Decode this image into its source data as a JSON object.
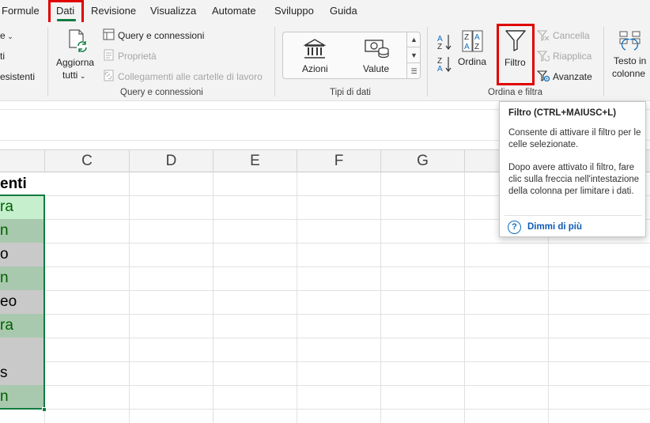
{
  "menu": {
    "tabs": [
      {
        "label": "Formule"
      },
      {
        "label": "Dati"
      },
      {
        "label": "Revisione"
      },
      {
        "label": "Visualizza"
      },
      {
        "label": "Automate"
      },
      {
        "label": "Sviluppo"
      },
      {
        "label": "Guida"
      }
    ],
    "active_tab": "Dati"
  },
  "ribbon": {
    "left_cut": {
      "item1": "e",
      "item2": "ti",
      "item3": "esistenti"
    },
    "query_group": {
      "refresh_label_1": "Aggiorna",
      "refresh_label_2": "tutti",
      "queries_connections": "Query e connessioni",
      "properties": "Proprietà",
      "edit_links": "Collegamenti alle cartelle di lavoro",
      "group_label": "Query e connessioni"
    },
    "datatypes_group": {
      "stocks": "Azioni",
      "currencies": "Valute",
      "group_label": "Tipi di dati"
    },
    "sort_filter_group": {
      "sort": "Ordina",
      "filter": "Filtro",
      "clear": "Cancella",
      "reapply": "Riapplica",
      "advanced": "Avanzate",
      "group_label": "Ordina e filtra"
    },
    "data_tools_group": {
      "text_to_columns_1": "Testo in",
      "text_to_columns_2": "colonne"
    }
  },
  "grid": {
    "columns": [
      "C",
      "D",
      "E",
      "F",
      "G"
    ],
    "column_b_cells": [
      {
        "text": "enti",
        "bold": true,
        "fill": "#ffffff",
        "color": "#000000"
      },
      {
        "text": "ra",
        "bold": false,
        "fill": "#c6efce",
        "color": "#006100"
      },
      {
        "text": "n",
        "bold": false,
        "fill": "#a9c9ae",
        "color": "#006100"
      },
      {
        "text": "o",
        "bold": false,
        "fill": "#c9c9c9",
        "color": "#000000"
      },
      {
        "text": "n",
        "bold": false,
        "fill": "#a9c9ae",
        "color": "#006100"
      },
      {
        "text": "eo",
        "bold": false,
        "fill": "#c9c9c9",
        "color": "#000000"
      },
      {
        "text": "ra",
        "bold": false,
        "fill": "#a9c9ae",
        "color": "#006100"
      },
      {
        "text": "",
        "bold": false,
        "fill": "#c9c9c9",
        "color": "#000000"
      },
      {
        "text": "s",
        "bold": false,
        "fill": "#c9c9c9",
        "color": "#000000"
      },
      {
        "text": "n",
        "bold": false,
        "fill": "#a9c9ae",
        "color": "#006100"
      }
    ]
  },
  "tooltip": {
    "title": "Filtro (CTRL+MAIUSC+L)",
    "paragraph1": "Consente di attivare il filtro per le celle selezionate.",
    "paragraph2": "Dopo avere attivato il filtro, fare clic sulla freccia nell'intestazione della colonna per limitare i dati.",
    "help_link": "Dimmi di più",
    "help_icon": "question-circle-icon"
  },
  "colors": {
    "accent_green": "#107c41",
    "highlight_red": "#e00000",
    "link_blue": "#0f5bb5"
  }
}
